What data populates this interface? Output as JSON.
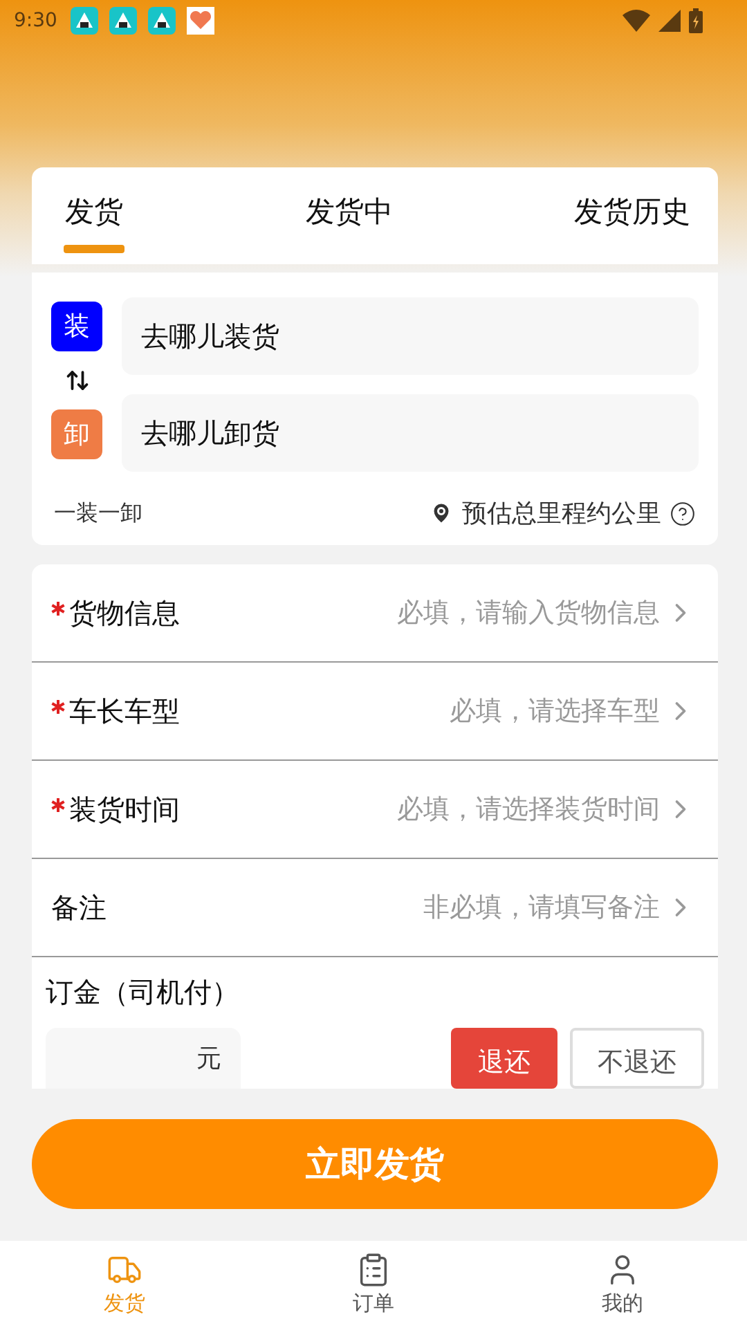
{
  "status_bar": {
    "time": "9:30"
  },
  "tabs": [
    {
      "label": "发货",
      "selected": true
    },
    {
      "label": "发货中",
      "selected": false
    },
    {
      "label": "发货历史",
      "selected": false
    }
  ],
  "route": {
    "stops": [
      {
        "kind": "load",
        "badge": "装",
        "placeholder": "去哪儿装货"
      },
      {
        "kind": "unload",
        "badge": "卸",
        "placeholder": "去哪儿卸货"
      }
    ],
    "mode": "一装一卸",
    "distance": "预估总里程约公里"
  },
  "form": {
    "rows": [
      {
        "label": "货物信息",
        "required": true,
        "hint": "必填，请输入货物信息"
      },
      {
        "label": "车长车型",
        "required": true,
        "hint": "必填，请选择车型"
      },
      {
        "label": "装货时间",
        "required": true,
        "hint": "必填，请选择装货时间"
      },
      {
        "label": "备注",
        "required": false,
        "hint": "非必填，请填写备注"
      }
    ],
    "deposit": {
      "label": "订金（司机付）",
      "unit": "元",
      "options": [
        {
          "label": "退还",
          "selected": true
        },
        {
          "label": "不退还",
          "selected": false
        }
      ]
    }
  },
  "submit": "立即发货",
  "nav": [
    {
      "label": "发货",
      "selected": true
    },
    {
      "label": "订单",
      "selected": false
    },
    {
      "label": "我的",
      "selected": false
    }
  ]
}
